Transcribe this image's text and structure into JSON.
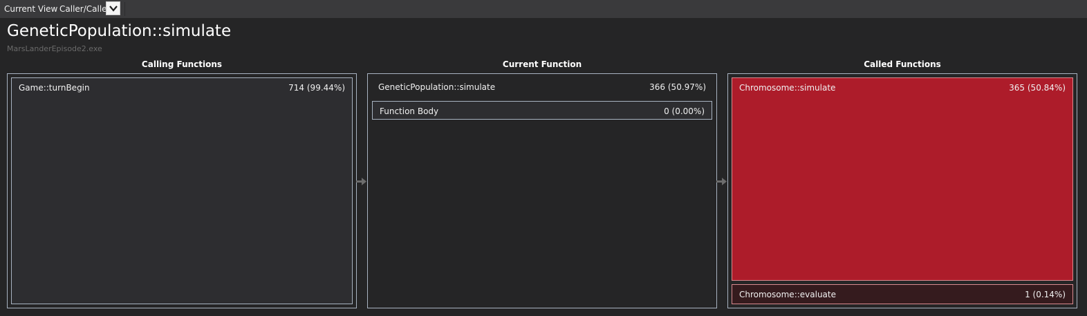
{
  "toolbar": {
    "view_label": "Current View:",
    "view_value": "Caller/Callee"
  },
  "header": {
    "title": "GeneticPopulation::simulate",
    "subtitle": "MarsLanderEpisode2.exe"
  },
  "columns": {
    "calling": {
      "title": "Calling Functions",
      "items": [
        {
          "name": "Game::turnBegin",
          "value": "714 (99.44%)"
        }
      ]
    },
    "current": {
      "title": "Current Function",
      "name": "GeneticPopulation::simulate",
      "value": "366 (50.97%)",
      "body": {
        "name": "Function Body",
        "value": "0 (0.00%)"
      }
    },
    "called": {
      "title": "Called Functions",
      "items": [
        {
          "name": "Chromosome::simulate",
          "value": "365 (50.84%)"
        },
        {
          "name": "Chromosome::evaluate",
          "value": "1 (0.14%)"
        }
      ]
    }
  },
  "icons": {
    "dropdown": "chevron-down-icon",
    "flow": "arrow-right-icon"
  },
  "colors": {
    "hot": "#ad1c2a",
    "hot_border": "#d98a8f",
    "cold": "#351b1e",
    "panel_border": "#a9b4c2",
    "cell_bg": "#2d2d30"
  }
}
